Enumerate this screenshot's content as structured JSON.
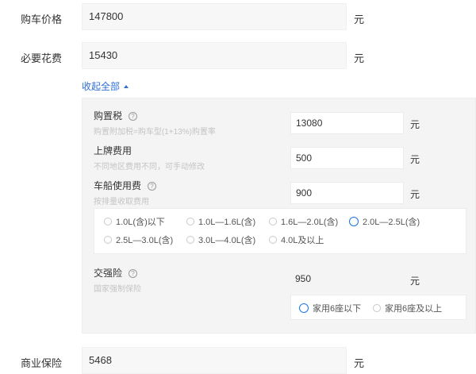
{
  "purchase_price": {
    "label": "购车价格",
    "value": "147800",
    "unit": "元"
  },
  "required_costs": {
    "label": "必要花费",
    "value": "15430",
    "unit": "元"
  },
  "collapse_link": "收起全部",
  "purchase_tax": {
    "label": "购置税",
    "hint": "购置附加税=购车型(1+13%)购置率",
    "value": "13080",
    "unit": "元"
  },
  "registration_fee": {
    "label": "上牌费用",
    "hint": "不同地区费用不同，可手动修改",
    "value": "500",
    "unit": "元"
  },
  "vehicle_tax": {
    "label": "车船使用费",
    "hint": "按排量收取费用",
    "value": "900",
    "unit": "元",
    "options": [
      "1.0L(含)以下",
      "1.0L—1.6L(含)",
      "1.6L—2.0L(含)",
      "2.0L—2.5L(含)",
      "2.5L—3.0L(含)",
      "3.0L—4.0L(含)",
      "4.0L及以上"
    ],
    "selected": "2.0L—2.5L(含)"
  },
  "compulsory_insurance": {
    "label": "交强险",
    "hint": "国家强制保险",
    "value": "950",
    "unit": "元",
    "options": [
      "家用6座以下",
      "家用6座及以上"
    ],
    "selected": "家用6座以下"
  },
  "commercial_insurance": {
    "label": "商业保险",
    "value": "5468",
    "unit": "元"
  },
  "colors": {
    "accent": "#1a73e8",
    "link": "#2f6fd6"
  },
  "icons": {
    "help": "help-icon",
    "collapse": "caret-up-icon",
    "radio": "radio-icon"
  }
}
